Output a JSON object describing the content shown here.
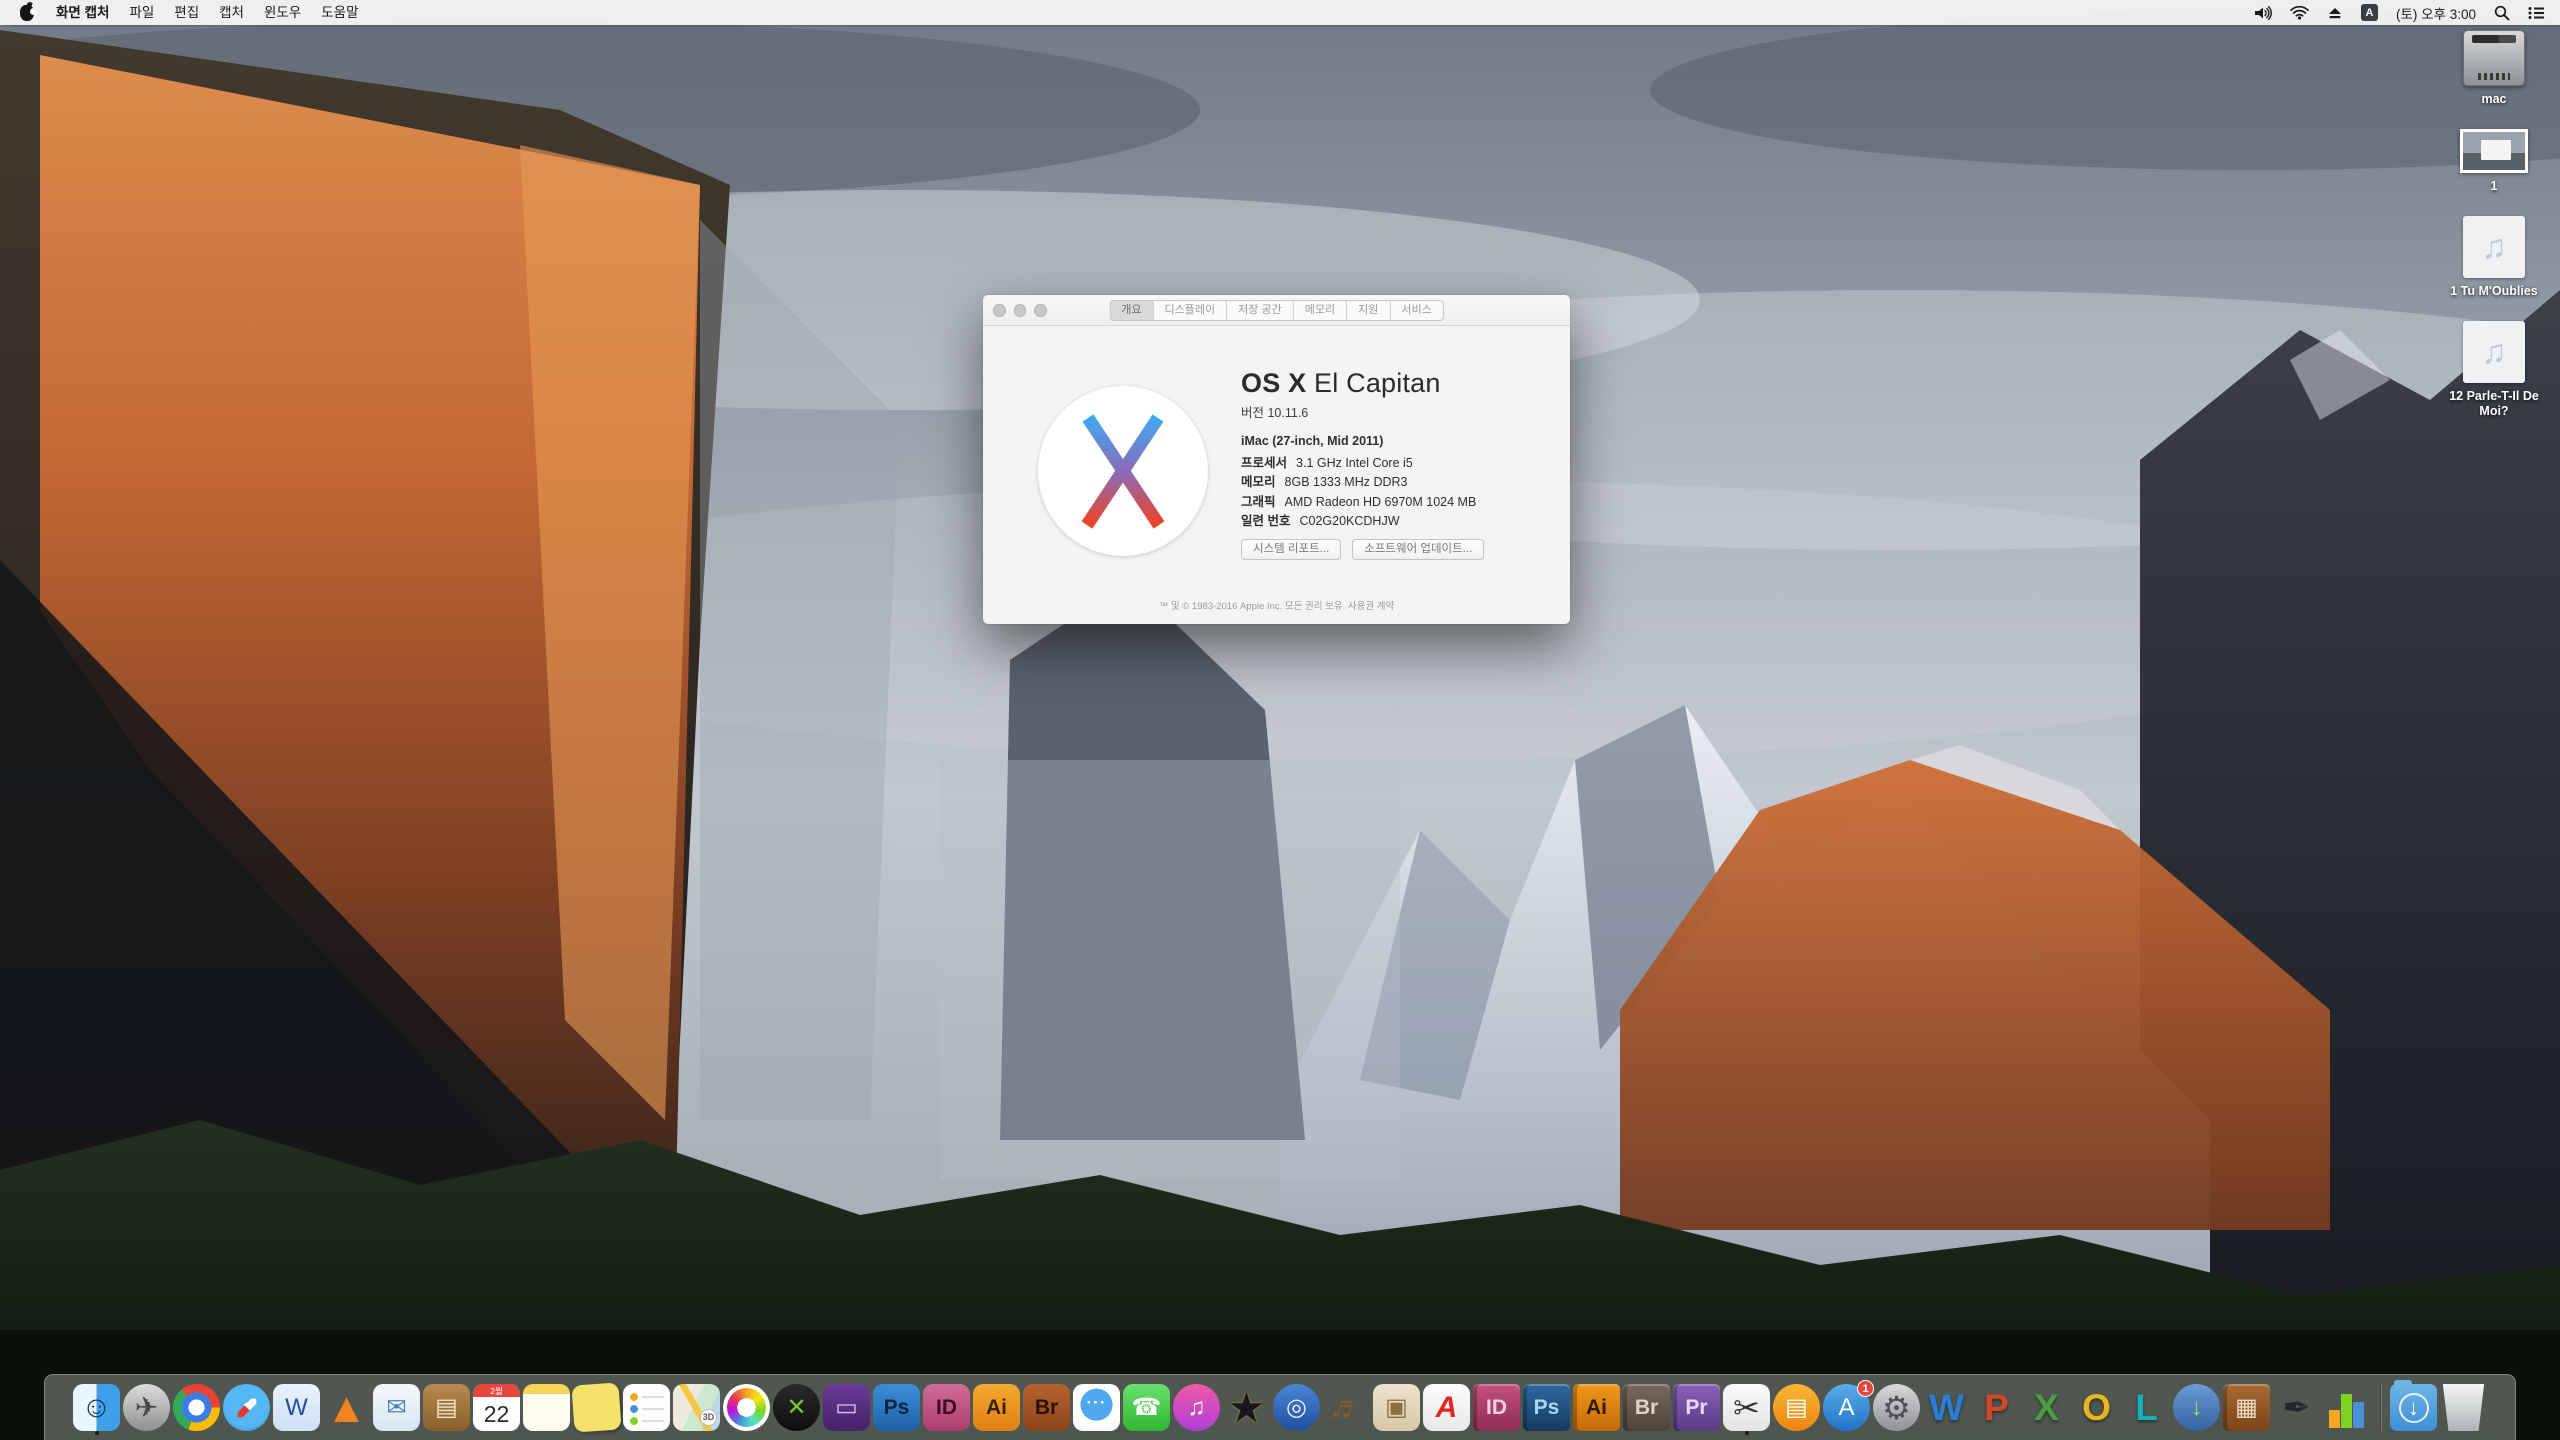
{
  "menu_bar": {
    "app_menus": [
      {
        "label": "화면 캡처",
        "bold": true
      },
      {
        "label": "파일"
      },
      {
        "label": "편집"
      },
      {
        "label": "캡처"
      },
      {
        "label": "윈도우"
      },
      {
        "label": "도움말"
      }
    ],
    "status": {
      "input_source": "A",
      "clock": "(토) 오후 3:00"
    }
  },
  "about_window": {
    "tabs": [
      {
        "label": "개요",
        "selected": true
      },
      {
        "label": "디스플레이",
        "selected": false
      },
      {
        "label": "저장 공간",
        "selected": false
      },
      {
        "label": "메모리",
        "selected": false
      },
      {
        "label": "지원",
        "selected": false
      },
      {
        "label": "서비스",
        "selected": false
      }
    ],
    "title_strong": "OS X",
    "title_light": "El Capitan",
    "version": "버전 10.11.6",
    "model": "iMac (27-inch, Mid 2011)",
    "specs": [
      {
        "label": "프로세서",
        "value": "3.1 GHz Intel Core i5"
      },
      {
        "label": "메모리",
        "value": "8GB 1333 MHz DDR3"
      },
      {
        "label": "그래픽",
        "value": "AMD Radeon HD 6970M 1024 MB"
      },
      {
        "label": "일련 번호",
        "value": "C02G20KCDHJW"
      }
    ],
    "buttons": [
      {
        "label": "시스템 리포트..."
      },
      {
        "label": "소프트웨어 업데이트..."
      }
    ],
    "footer": "™ 및 © 1983-2016 Apple Inc. 모든 권리 보유. 사용권 계약"
  },
  "desktop_icons": [
    {
      "name": "hard-drive",
      "type": "drive",
      "label": "mac"
    },
    {
      "name": "screenshot-file",
      "type": "image",
      "label": "1"
    },
    {
      "name": "audio-file",
      "type": "audio",
      "label": "1 Tu M'Oublies"
    },
    {
      "name": "audio-file",
      "type": "audio",
      "label": "12 Parle-T-Il De Moi?"
    }
  ],
  "dock": {
    "items": [
      {
        "name": "finder",
        "glyph": "☺",
        "active": true
      },
      {
        "name": "launchpad",
        "shape": "circle",
        "c1": "#dcdcdc",
        "c2": "#8e9092",
        "glyph": "✈",
        "fg": "#46484a"
      },
      {
        "name": "chrome",
        "shape": "circle"
      },
      {
        "name": "safari",
        "shape": "circle"
      },
      {
        "name": "webhard",
        "c1": "#eaf2fc",
        "c2": "#cfe0f5",
        "glyph": "W",
        "fg": "#1d4fa5"
      },
      {
        "name": "vlc",
        "shape": "bare",
        "glyph": "▲",
        "fg": "#f58220"
      },
      {
        "name": "mail",
        "c1": "#f4f8fc",
        "c2": "#d8e6f2",
        "glyph": "✉",
        "fg": "#4a7fb5"
      },
      {
        "name": "contacts",
        "c1": "#b98a4e",
        "c2": "#8a5f2d",
        "glyph": "▤",
        "fg": "#f2e3c8"
      },
      {
        "name": "calendar",
        "cal": {
          "month": "2월",
          "day": "22"
        }
      },
      {
        "name": "notes"
      },
      {
        "name": "stickies"
      },
      {
        "name": "reminders"
      },
      {
        "name": "maps",
        "glyph": "3D"
      },
      {
        "name": "photos",
        "shape": "circle"
      },
      {
        "name": "media-converter",
        "shape": "circle",
        "c1": "#2a2a2c",
        "c2": "#0e0e10",
        "glyph": "✕",
        "fg": "#7ac72e"
      },
      {
        "name": "toast",
        "c1": "#6a3a96",
        "c2": "#46226a",
        "glyph": "▭",
        "fg": "#d4c2ec"
      },
      {
        "name": "photoshop-cs4",
        "c1": "#3c8ed8",
        "c2": "#1f62a8",
        "glyph": "Ps",
        "fg": "#0b2540"
      },
      {
        "name": "indesign-cs4",
        "c1": "#d06c97",
        "c2": "#aa3f6e",
        "glyph": "ID",
        "fg": "#3c0e22"
      },
      {
        "name": "illustrator-cs4",
        "c1": "#f5a930",
        "c2": "#e07f12",
        "glyph": "Ai",
        "fg": "#3a2302"
      },
      {
        "name": "bridge-cs4",
        "c1": "#b5622e",
        "c2": "#8c451a",
        "glyph": "Br",
        "fg": "#2b1205"
      },
      {
        "name": "messages",
        "glyph": "···",
        "fg": "#ffffff"
      },
      {
        "name": "facetime",
        "c1": "#6ae06e",
        "c2": "#2fb832",
        "glyph": "☎",
        "fg": "#ffffff"
      },
      {
        "name": "itunes",
        "shape": "circle",
        "c1": "#ef5aa8",
        "c2": "#b13ed6",
        "glyph": "♫",
        "fg": "#ffffff"
      },
      {
        "name": "imovie",
        "shape": "bare",
        "glyph": "★",
        "fg": "#17171d"
      },
      {
        "name": "dvd-ripper",
        "shape": "circle",
        "c1": "#4a86d8",
        "c2": "#1f4f9e",
        "glyph": "◎",
        "fg": "#e8f0fa"
      },
      {
        "name": "garageband",
        "shape": "bare",
        "glyph": "♬",
        "fg": "#8a5a28"
      },
      {
        "name": "photo-collage",
        "c1": "#ece2cc",
        "c2": "#d8c8a8",
        "glyph": "▣",
        "fg": "#8a6f40"
      },
      {
        "name": "acrobat-reader",
        "c1": "#fdfdfd",
        "c2": "#e8e8ea",
        "glyph": "A",
        "fg": "#e2261c"
      },
      {
        "name": "indesign-cs5",
        "c1": "#c4527c",
        "c2": "#8e2e52",
        "glyph": "ID",
        "fg": "#f5d0e0"
      },
      {
        "name": "photoshop-cs5",
        "c1": "#2f6a9e",
        "c2": "#153a60",
        "glyph": "Ps",
        "fg": "#a8d8f5"
      },
      {
        "name": "illustrator-cs5",
        "c1": "#f09a1a",
        "c2": "#c46a08",
        "glyph": "Ai",
        "fg": "#2f1c00"
      },
      {
        "name": "bridge-cs5",
        "c1": "#7a6a5e",
        "c2": "#4e4138",
        "glyph": "Br",
        "fg": "#e0d4c4"
      },
      {
        "name": "premiere-cs5",
        "c1": "#8a62b8",
        "c2": "#5a3a85",
        "glyph": "Pr",
        "fg": "#ead8fa"
      },
      {
        "name": "screen-capture",
        "c1": "#fafafa",
        "c2": "#e4e4e6",
        "glyph": "✂",
        "fg": "#333333",
        "active": true
      },
      {
        "name": "ibooks",
        "shape": "circle",
        "c1": "#f7b733",
        "c2": "#ee8510",
        "glyph": "▤",
        "fg": "#ffffff"
      },
      {
        "name": "app-store",
        "shape": "circle",
        "c1": "#5aade8",
        "c2": "#2272c8",
        "glyph": "A",
        "fg": "#ffffff",
        "badge": "1"
      },
      {
        "name": "system-preferences",
        "shape": "circle",
        "c1": "#d8d8da",
        "c2": "#909296",
        "glyph": "⚙",
        "fg": "#4e5052"
      },
      {
        "name": "word",
        "shape": "bare",
        "letter": true,
        "glyph": "W",
        "fg": "#2b7cd3"
      },
      {
        "name": "powerpoint",
        "shape": "bare",
        "letter": true,
        "glyph": "P",
        "fg": "#d24726"
      },
      {
        "name": "excel",
        "shape": "bare",
        "letter": true,
        "glyph": "X",
        "fg": "#4a9e3f"
      },
      {
        "name": "outlook",
        "shape": "bare",
        "letter": true,
        "glyph": "O",
        "fg": "#eab41c"
      },
      {
        "name": "lync",
        "shape": "bare",
        "letter": true,
        "glyph": "L",
        "fg": "#18aebe"
      },
      {
        "name": "download-manager",
        "shape": "circle",
        "c1": "#6a9ad8",
        "c2": "#35649e",
        "glyph": "↓",
        "fg": "#9ae060"
      },
      {
        "name": "keynote",
        "c1": "#a86a34",
        "c2": "#7a4518",
        "glyph": "▦",
        "fg": "#ecdcc4"
      },
      {
        "name": "pages",
        "shape": "bare",
        "glyph": "✒",
        "fg": "#26262e"
      },
      {
        "name": "numbers"
      },
      {
        "divider": true
      },
      {
        "name": "downloads-folder",
        "glyph": "↓",
        "fg": "#ffffff"
      },
      {
        "name": "trash"
      }
    ]
  }
}
